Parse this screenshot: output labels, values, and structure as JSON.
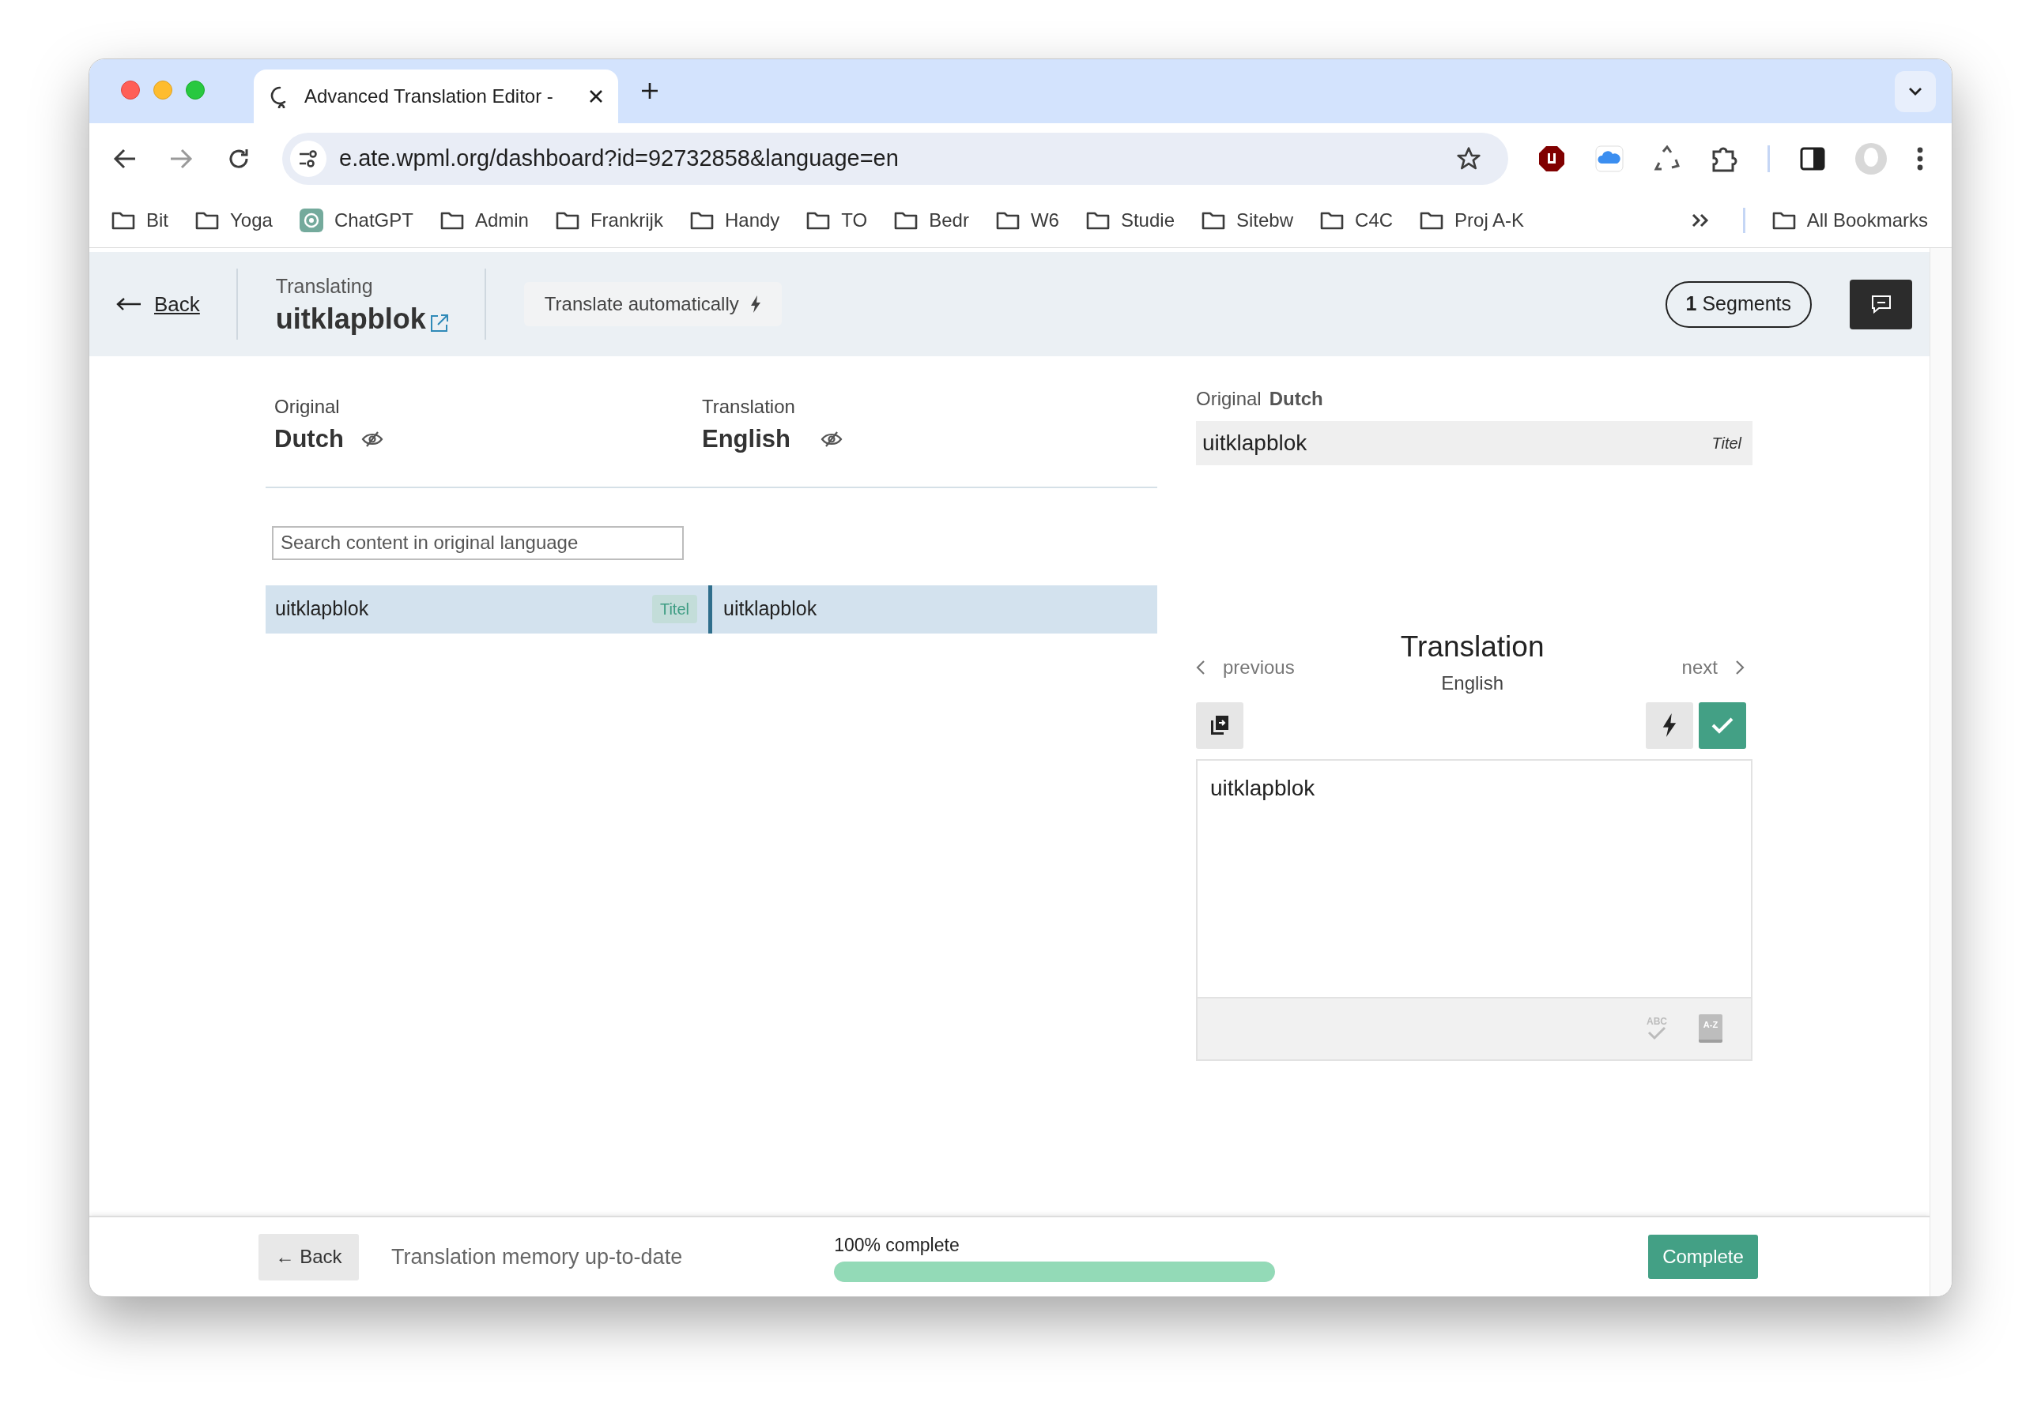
{
  "browser": {
    "tabs": [
      {
        "title": "Advanced Translation Editor -",
        "selected": true
      }
    ],
    "address": "e.ate.wpml.org/dashboard?id=92732858&language=en",
    "bookmarks": [
      {
        "label": "Bit",
        "kind": "folder"
      },
      {
        "label": "Yoga",
        "kind": "folder"
      },
      {
        "label": "ChatGPT",
        "kind": "app"
      },
      {
        "label": "Admin",
        "kind": "folder"
      },
      {
        "label": "Frankrijk",
        "kind": "folder"
      },
      {
        "label": "Handy",
        "kind": "folder"
      },
      {
        "label": "TO",
        "kind": "folder"
      },
      {
        "label": "Bedr",
        "kind": "folder"
      },
      {
        "label": "W6",
        "kind": "folder"
      },
      {
        "label": "Studie",
        "kind": "folder"
      },
      {
        "label": "Sitebw",
        "kind": "folder"
      },
      {
        "label": "C4C",
        "kind": "folder"
      },
      {
        "label": "Proj A-K",
        "kind": "folder"
      }
    ],
    "all_bookmarks": "All Bookmarks"
  },
  "header": {
    "back": "Back",
    "subtitle": "Translating",
    "title": "uitklapblok",
    "auto_button": "Translate automatically",
    "segments": "**1** Segments"
  },
  "languages": {
    "original_label": "Original",
    "original": "Dutch",
    "translation_label": "Translation",
    "translation": "English"
  },
  "search": {
    "placeholder": "Search content in original language"
  },
  "segments": [
    {
      "original": "uitklapblok",
      "tag": "Titel",
      "translation": "uitklapblok",
      "selected": true
    }
  ],
  "source_panel": {
    "label": "Original",
    "language": "Dutch",
    "text": "uitklapblok",
    "tag": "Titel"
  },
  "editor": {
    "previous": "previous",
    "title": "Translation",
    "language": "English",
    "next": "next",
    "value": "uitklapblok",
    "spellcheck_label": "ABC",
    "glossary_label": "A-Z"
  },
  "footer": {
    "back": "← Back",
    "status": "Translation memory up-to-date",
    "progress_label": "100% complete",
    "level": 1,
    "complete": "Complete"
  }
}
